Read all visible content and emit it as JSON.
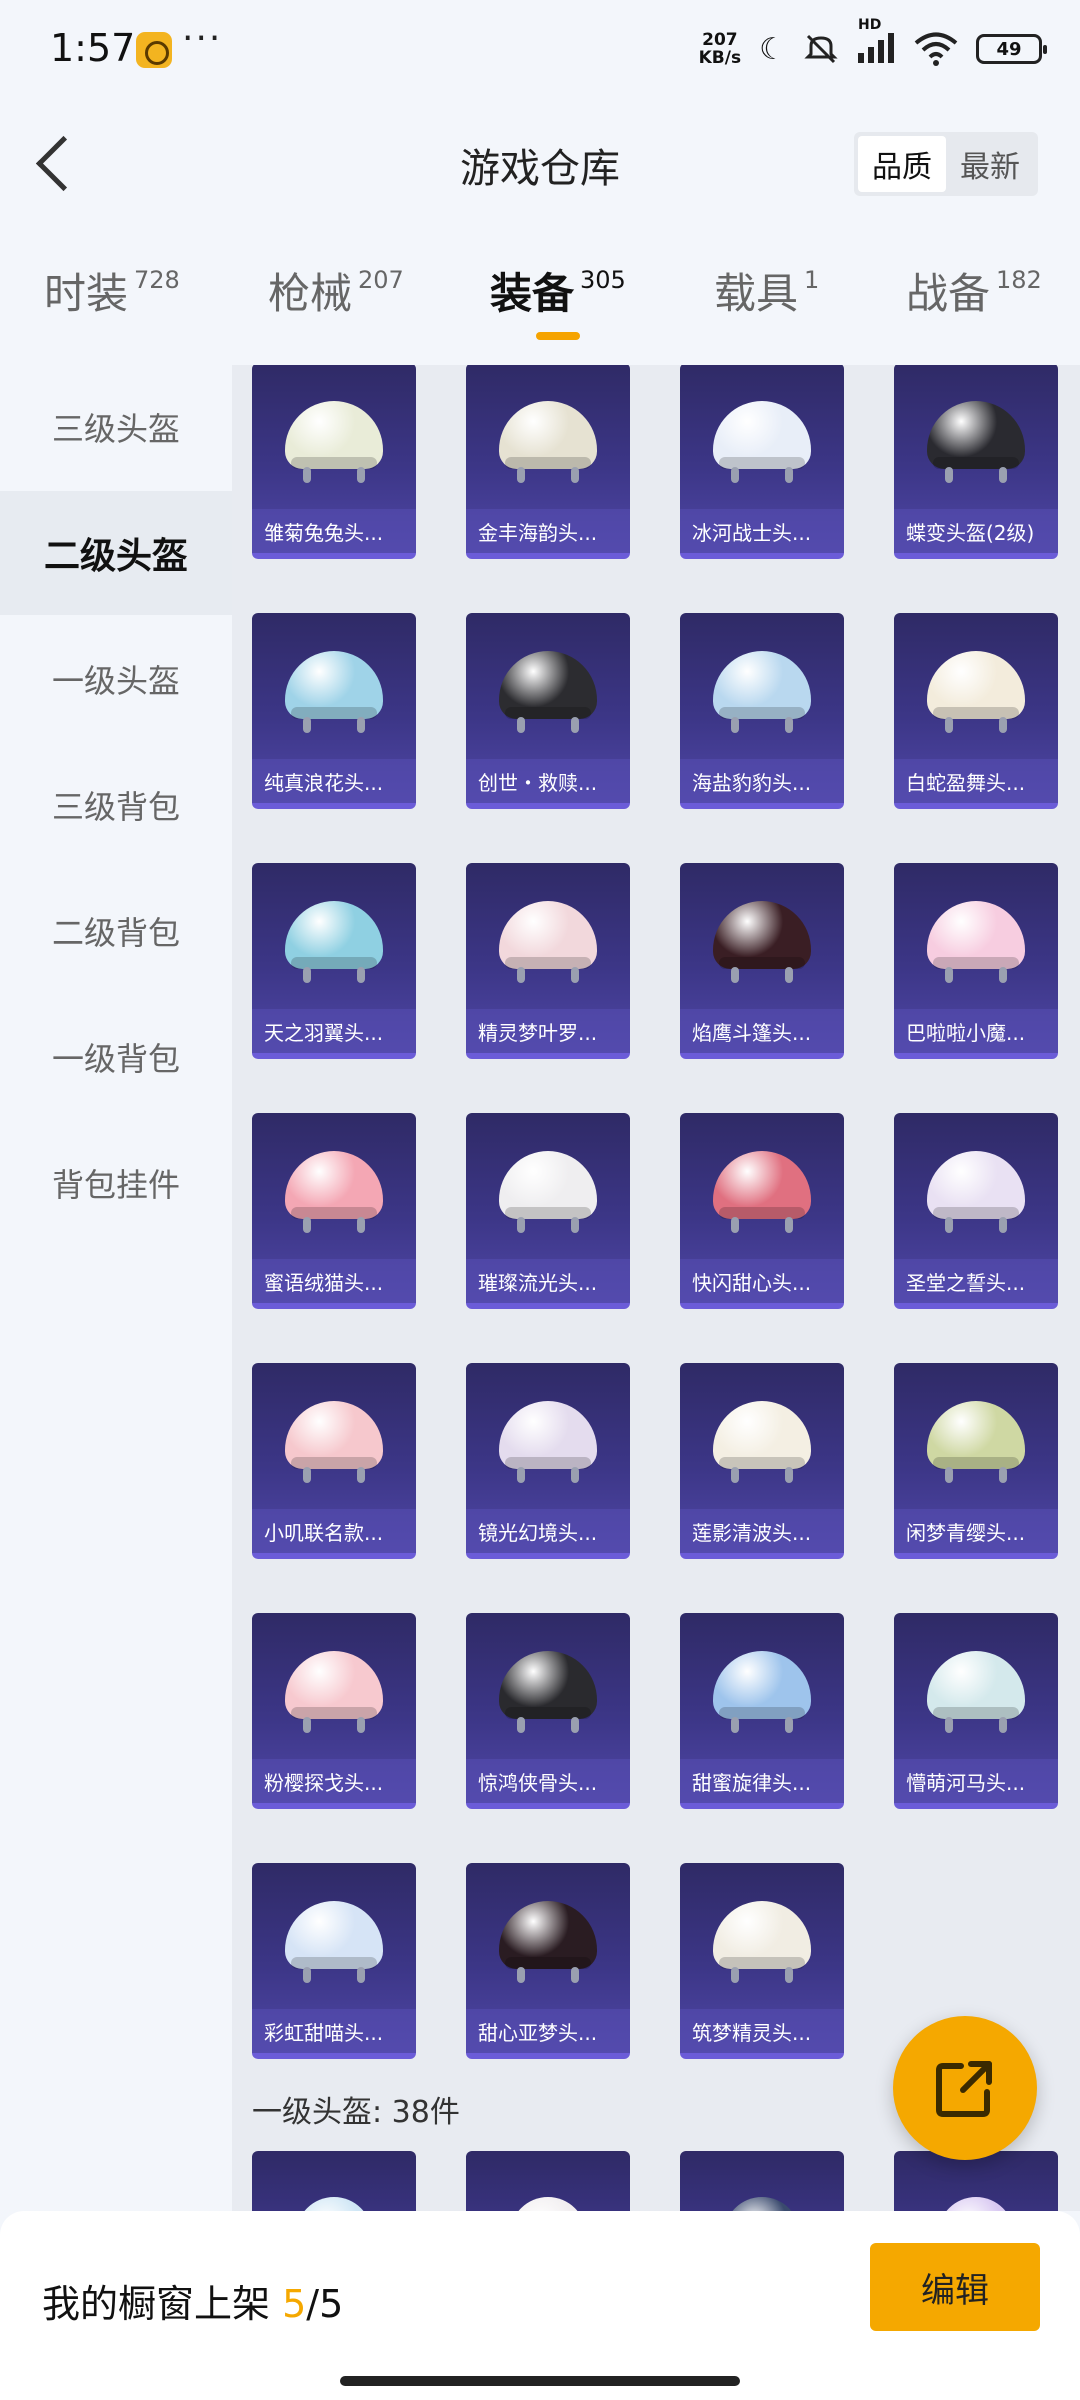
{
  "status_bar": {
    "time": "1:57",
    "more": "···",
    "net_speed_value": "207",
    "net_speed_unit": "KB/s",
    "signal_label": "HD",
    "battery": "49",
    "icons": [
      "moon-icon",
      "mute-icon",
      "signal-icon",
      "wifi-icon",
      "battery-icon"
    ]
  },
  "header": {
    "title": "游戏仓库",
    "sort_options": [
      {
        "label": "品质",
        "selected": true
      },
      {
        "label": "最新",
        "selected": false
      }
    ]
  },
  "tabs": [
    {
      "label": "时装",
      "count": "728",
      "active": false
    },
    {
      "label": "枪械",
      "count": "207",
      "active": false
    },
    {
      "label": "装备",
      "count": "305",
      "active": true
    },
    {
      "label": "载具",
      "count": "1",
      "active": false
    },
    {
      "label": "战备",
      "count": "182",
      "active": false
    }
  ],
  "sidebar": {
    "items": [
      {
        "label": "三级头盔",
        "active": false
      },
      {
        "label": "二级头盔",
        "active": true
      },
      {
        "label": "一级头盔",
        "active": false
      },
      {
        "label": "三级背包",
        "active": false
      },
      {
        "label": "二级背包",
        "active": false
      },
      {
        "label": "一级背包",
        "active": false
      },
      {
        "label": "背包挂件",
        "active": false
      }
    ]
  },
  "items": [
    {
      "name": "雏菊兔兔头...",
      "color": "#e9ecd8"
    },
    {
      "name": "金丰海韵头...",
      "color": "#e6e2d2"
    },
    {
      "name": "冰河战士头...",
      "color": "#e8eef8"
    },
    {
      "name": "蝶变头盔(2级)",
      "color": "#2a2a30"
    },
    {
      "name": "纯真浪花头...",
      "color": "#9fd3e8"
    },
    {
      "name": "创世・救赎...",
      "color": "#2c2c30"
    },
    {
      "name": "海盐豹豹头...",
      "color": "#b9d8ef"
    },
    {
      "name": "白蛇盈舞头...",
      "color": "#f3ecdc"
    },
    {
      "name": "天之羽翼头...",
      "color": "#8fd0e2"
    },
    {
      "name": "精灵梦叶罗...",
      "color": "#f2d8dc"
    },
    {
      "name": "焰鹰斗篷头...",
      "color": "#3a1e24"
    },
    {
      "name": "巴啦啦小魔...",
      "color": "#f7cde0"
    },
    {
      "name": "蜜语绒猫头...",
      "color": "#f4a7b4"
    },
    {
      "name": "璀璨流光头...",
      "color": "#efeef0"
    },
    {
      "name": "快闪甜心头...",
      "color": "#e07080"
    },
    {
      "name": "圣堂之誓头...",
      "color": "#e9e1f3"
    },
    {
      "name": "小叽联名款...",
      "color": "#f6c8cd"
    },
    {
      "name": "镜光幻境头...",
      "color": "#e4dcee"
    },
    {
      "name": "莲影清波头...",
      "color": "#f4efe3"
    },
    {
      "name": "闲梦青缨头...",
      "color": "#cfd8a3"
    },
    {
      "name": "粉樱探戈头...",
      "color": "#f7c9cf"
    },
    {
      "name": "惊鸿侠骨头...",
      "color": "#2a2a2e"
    },
    {
      "name": "甜蜜旋律头...",
      "color": "#9ec4ec"
    },
    {
      "name": "懵萌河马头...",
      "color": "#d4e9ec"
    },
    {
      "name": "彩虹甜喵头...",
      "color": "#d6e4f6"
    },
    {
      "name": "甜心亚梦头...",
      "color": "#2a1c22"
    },
    {
      "name": "筑梦精灵头...",
      "color": "#f1ede3"
    }
  ],
  "next_section": {
    "label": "一级头盔: 38件",
    "peek_colors": [
      "#cfe6f5",
      "#f1eef0",
      "#3a4a6e",
      "#d9c9f2"
    ]
  },
  "bottom_bar": {
    "showcase_label": "我的橱窗上架 ",
    "showcase_count": "5",
    "showcase_total": "/5",
    "edit_label": "编辑"
  },
  "colors": {
    "accent": "#f5a800",
    "card_bg": "#3c3687",
    "card_border": "#6b5cd8"
  }
}
